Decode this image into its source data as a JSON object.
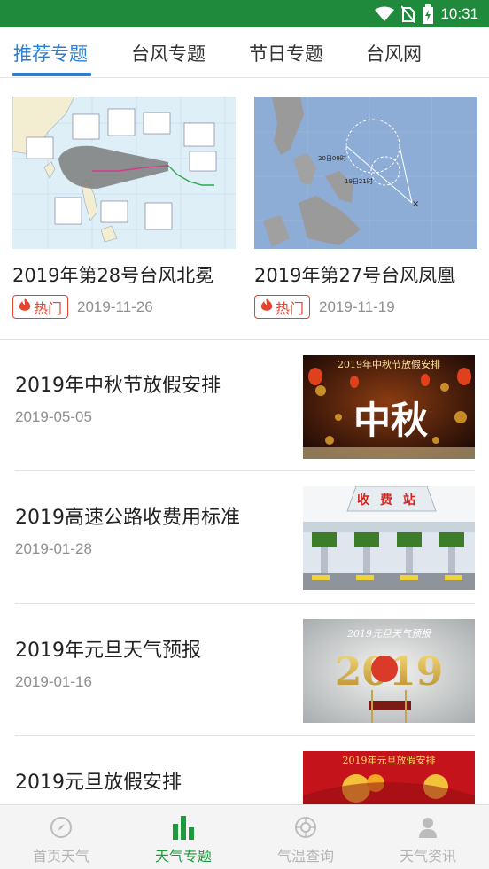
{
  "status_bar": {
    "time": "10:31",
    "icons": [
      "wifi-icon",
      "no-sim-icon",
      "battery-charging-icon"
    ]
  },
  "tabs": [
    {
      "label": "推荐专题",
      "active": true
    },
    {
      "label": "台风专题",
      "active": false
    },
    {
      "label": "节日专题",
      "active": false
    },
    {
      "label": "台风网",
      "active": false
    }
  ],
  "featured": [
    {
      "title": "2019年第28号台风北冕",
      "badge": "热门",
      "date": "2019-11-26"
    },
    {
      "title": "2019年第27号台风凤凰",
      "badge": "热门",
      "date": "2019-11-19"
    }
  ],
  "typhoon_map_27": {
    "labels": [
      "20日09时",
      "19日21时"
    ]
  },
  "topics": [
    {
      "title": "2019年中秋节放假安排",
      "date": "2019-05-05",
      "image_caption": "2019年中秋节放假安排",
      "image_text": "中秋"
    },
    {
      "title": "2019高速公路收费用标准",
      "date": "2019-01-28",
      "image_caption": "收费站"
    },
    {
      "title": "2019年元旦天气预报",
      "date": "2019-01-16",
      "image_caption": "2019元旦天气预报",
      "image_text": "2019"
    },
    {
      "title": "2019元旦放假安排",
      "date": "",
      "image_caption": "2019年元旦放假安排"
    }
  ],
  "bottom_nav": [
    {
      "label": "首页天气",
      "icon": "compass-icon",
      "active": false
    },
    {
      "label": "天气专题",
      "icon": "bar-chart-icon",
      "active": true
    },
    {
      "label": "气温查询",
      "icon": "thermometer-ball-icon",
      "active": false
    },
    {
      "label": "天气资讯",
      "icon": "person-icon",
      "active": false
    }
  ],
  "colors": {
    "status_bar": "#1f8a3b",
    "tab_active": "#2a7fd4",
    "hot": "#e5432e",
    "nav_active": "#1c9a3c"
  }
}
